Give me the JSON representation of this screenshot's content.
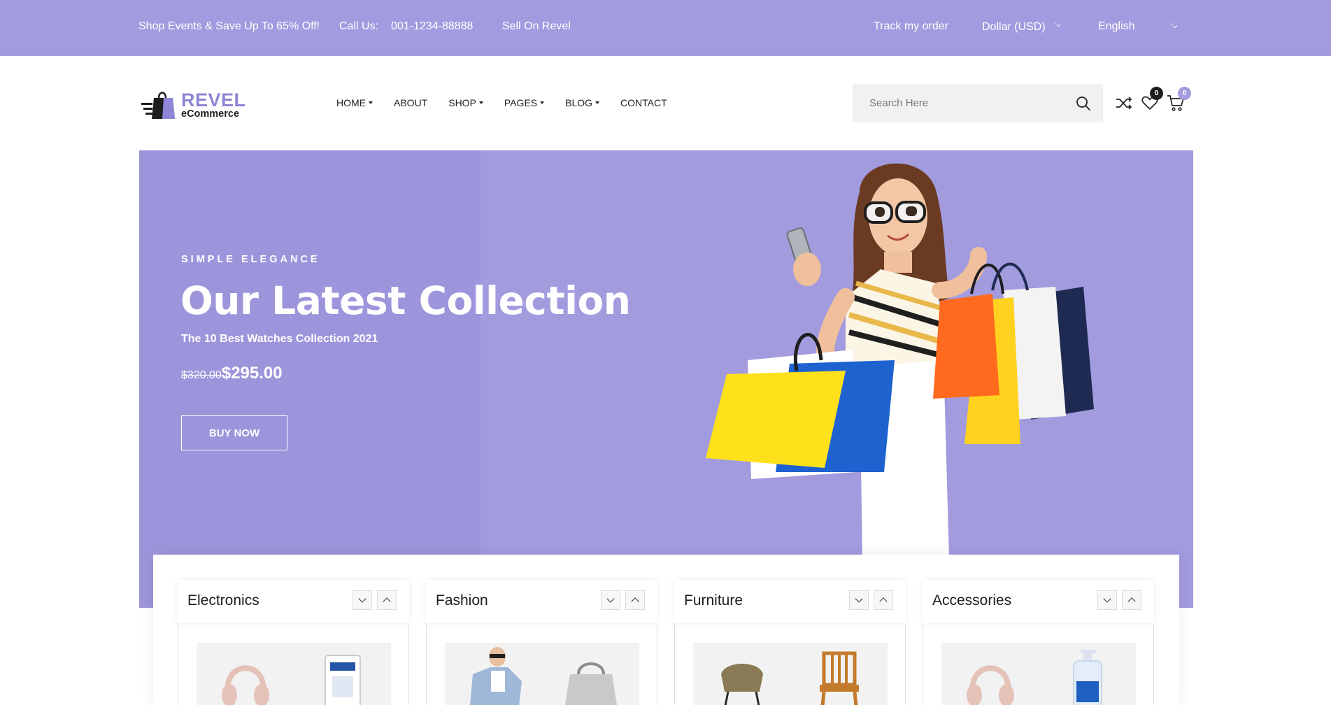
{
  "topbar": {
    "promo": "Shop Events & Save Up To 65% Off!",
    "call_label": "Call Us:",
    "phone": "001-1234-88888",
    "sell": "Sell On Revel",
    "track": "Track my order",
    "currency": "Dollar (USD)",
    "language": "English"
  },
  "logo": {
    "brand": "REVEL",
    "sub": "eCommerce"
  },
  "nav": {
    "home": "HOME",
    "about": "ABOUT",
    "shop": "SHOP",
    "pages": "PAGES",
    "blog": "BLOG",
    "contact": "CONTACT"
  },
  "search": {
    "placeholder": "Search Here"
  },
  "header_icons": {
    "compare_icon": "shuffle-icon",
    "wishlist_icon": "heart-icon",
    "cart_icon": "cart-icon",
    "wishlist_count": "0",
    "cart_count": "0"
  },
  "hero": {
    "eyebrow": "SIMPLE ELEGANCE",
    "title": "Our Latest Collection",
    "subtitle": "The 10 Best Watches Collection 2021",
    "old_price": "$320.00",
    "new_price": "$295.00",
    "cta": "BUY NOW"
  },
  "categories": [
    {
      "name": "Electronics"
    },
    {
      "name": "Fashion"
    },
    {
      "name": "Furniture"
    },
    {
      "name": "Accessories"
    }
  ],
  "colors": {
    "accent": "#a29bdf",
    "badge_dark": "#1d1d1d",
    "text_dark": "#222222"
  }
}
